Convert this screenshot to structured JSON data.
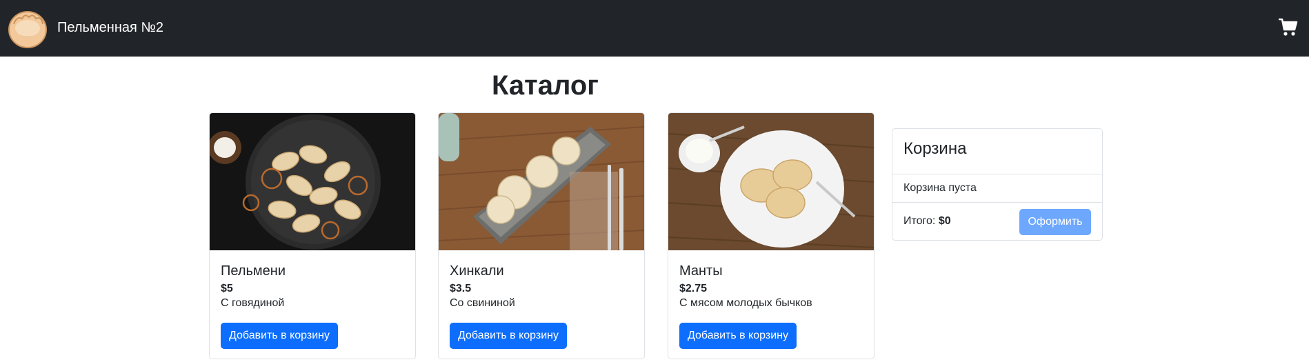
{
  "navbar": {
    "brand": "Пельменная №2",
    "logo_icon": "dumpling-logo-icon",
    "cart_icon": "shopping-cart-icon",
    "background": "#212529"
  },
  "catalog": {
    "title": "Каталог",
    "products": [
      {
        "name": "Пельмени",
        "price": "$5",
        "description": "С говядиной",
        "button_label": "Добавить в корзину",
        "image": "pelmeni-photo"
      },
      {
        "name": "Хинкали",
        "price": "$3.5",
        "description": "Со свининой",
        "button_label": "Добавить в корзину",
        "image": "khinkali-photo"
      },
      {
        "name": "Манты",
        "price": "$2.75",
        "description": "С мясом молодых бычков",
        "button_label": "Добавить в корзину",
        "image": "manty-photo"
      }
    ]
  },
  "basket": {
    "title": "Корзина",
    "empty_text": "Корзина пуста",
    "total_label": "Итого:",
    "total_value": "$0",
    "checkout_label": "Оформить"
  },
  "colors": {
    "primary": "#0d6efd",
    "primary_disabled": "#6ea8fe",
    "border": "#dee2e6"
  }
}
